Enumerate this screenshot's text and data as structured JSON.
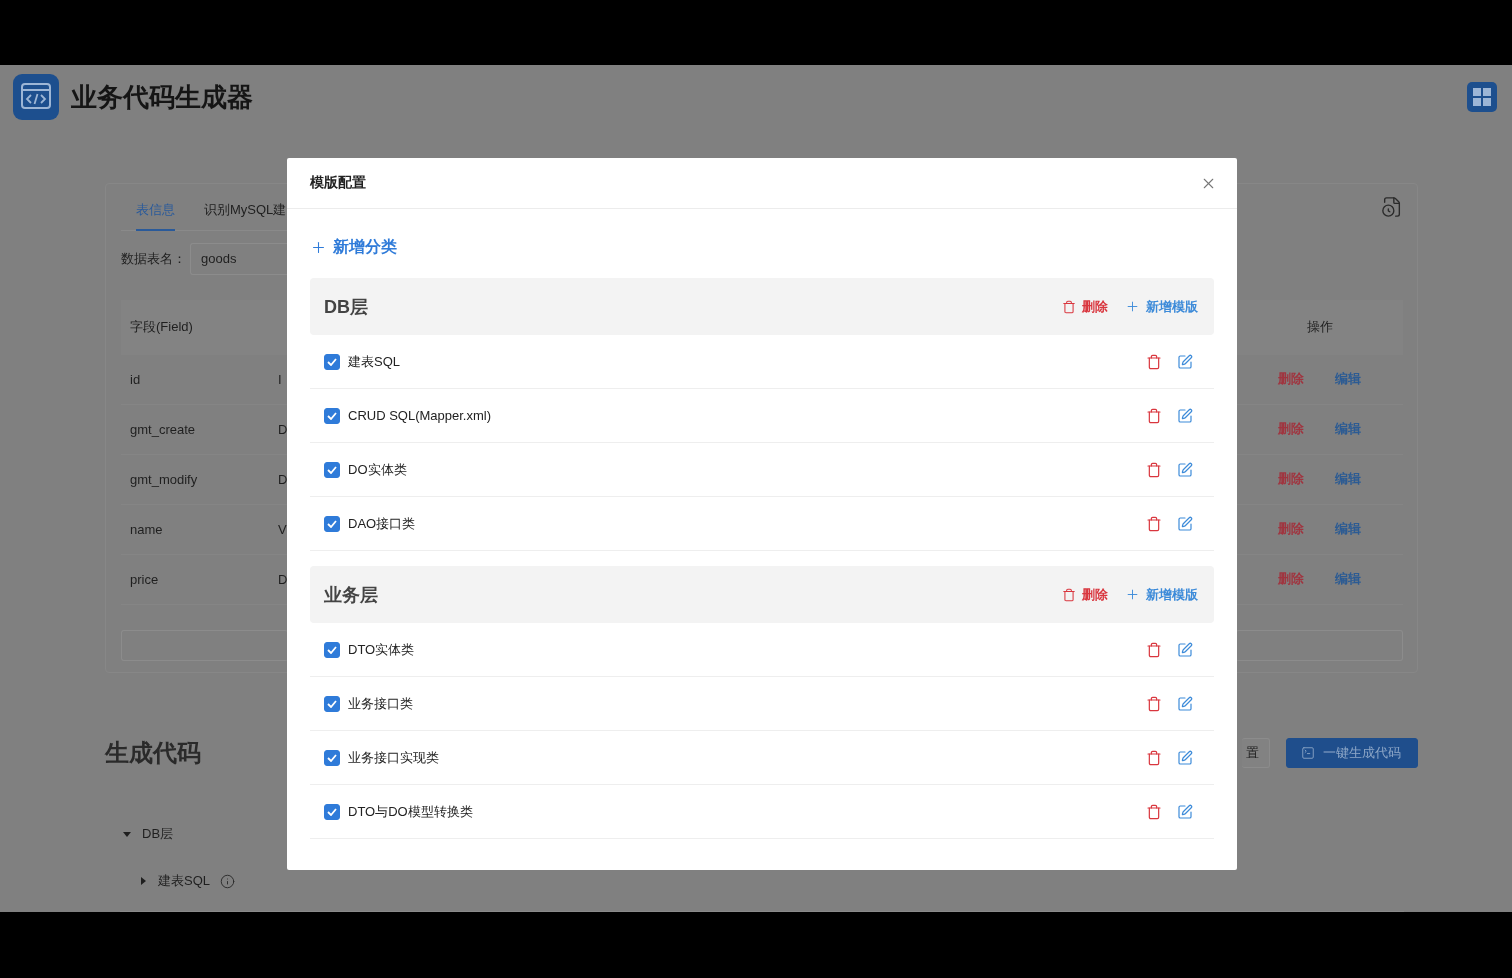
{
  "app": {
    "title": "业务代码生成器"
  },
  "table_panel": {
    "tabs": [
      {
        "label": "表信息",
        "selected": true
      },
      {
        "label": "识别MySQL建",
        "selected": false
      }
    ],
    "table_name": {
      "label": "数据表名：",
      "value": "goods"
    },
    "columns": [
      "字段(Field)",
      "操作"
    ],
    "rows": [
      {
        "field": "id",
        "column_2": "I",
        "actions": [
          "删除",
          "编辑"
        ]
      },
      {
        "field": "gmt_create",
        "column_2": "D",
        "actions": [
          "删除",
          "编辑"
        ]
      },
      {
        "field": "gmt_modify",
        "column_2": "D",
        "actions": [
          "删除",
          "编辑"
        ]
      },
      {
        "field": "name",
        "column_2": "V",
        "actions": [
          "删除",
          "编辑"
        ]
      },
      {
        "field": "price",
        "column_2": "D",
        "actions": [
          "删除",
          "编辑"
        ]
      }
    ]
  },
  "generate": {
    "title": "生成代码",
    "buttons": [
      {
        "label": "置",
        "kind": "secondary"
      },
      {
        "label": "一键生成代码",
        "kind": "primary"
      }
    ],
    "tree": [
      {
        "label": "DB层",
        "expanded": true,
        "children": [
          {
            "label": "建表SQL",
            "expanded": false
          }
        ]
      }
    ]
  },
  "dialog": {
    "title": "模版配置",
    "add_category": "新增分类",
    "groups": [
      {
        "name": "DB层",
        "delete": "删除",
        "add_template": "新增模版",
        "templates": [
          {
            "name": "建表SQL",
            "checked": true
          },
          {
            "name": "CRUD SQL(Mapper.xml)",
            "checked": true
          },
          {
            "name": "DO实体类",
            "checked": true
          },
          {
            "name": "DAO接口类",
            "checked": true
          }
        ]
      },
      {
        "name": "业务层",
        "delete": "删除",
        "add_template": "新增模版",
        "templates": [
          {
            "name": "DTO实体类",
            "checked": true
          },
          {
            "name": "业务接口类",
            "checked": true
          },
          {
            "name": "业务接口实现类",
            "checked": true
          },
          {
            "name": "DTO与DO模型转换类",
            "checked": true
          }
        ]
      }
    ]
  }
}
